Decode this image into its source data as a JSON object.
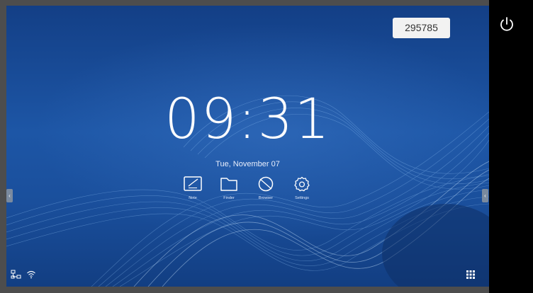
{
  "status_badge": {
    "code": "295785"
  },
  "clock": {
    "time": "09:31",
    "date": "Tue, November 07"
  },
  "apps": [
    {
      "label": "Note",
      "icon": "note-icon"
    },
    {
      "label": "Finder",
      "icon": "folder-icon"
    },
    {
      "label": "Browser",
      "icon": "browser-icon"
    },
    {
      "label": "Settings",
      "icon": "gear-icon"
    }
  ],
  "side_handles": {
    "left": "‹",
    "right": "‹"
  },
  "tray_icons": [
    "network-icon",
    "wifi-icon",
    "apps-grid-icon",
    "power-icon"
  ],
  "colors": {
    "background": "#1a4f9c",
    "panel": "#000000",
    "frame": "#4d4d4d",
    "badge": "#f2f2f2"
  }
}
